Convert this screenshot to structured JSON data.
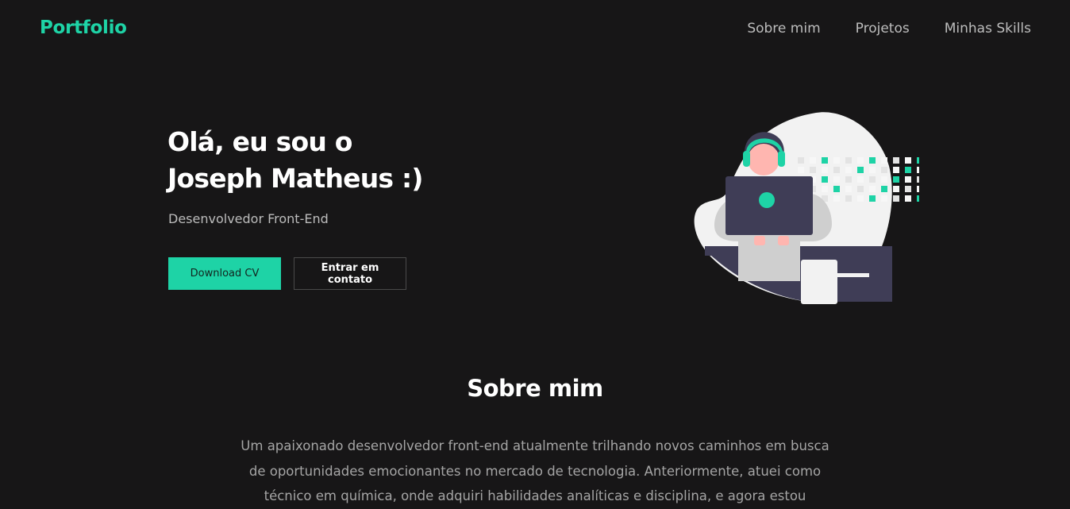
{
  "header": {
    "logo": "Portfolio",
    "nav": [
      "Sobre mim",
      "Projetos",
      "Minhas Skills"
    ]
  },
  "hero": {
    "title_line1": "Olá, eu sou o",
    "title_line2": "Joseph Matheus :)",
    "subtitle": "Desenvolvedor Front-End",
    "primary_button": "Download CV",
    "secondary_button": "Entrar em contato",
    "illustration_icon": "developer-at-laptop-illustration"
  },
  "about": {
    "title": "Sobre mim",
    "text": "Um apaixonado desenvolvedor front-end atualmente trilhando novos caminhos em busca de oportunidades emocionantes no mercado de tecnologia. Anteriormente, atuei como técnico em química, onde adquiri habilidades analíticas e disciplina, e agora estou"
  },
  "colors": {
    "background": "#171617",
    "accent": "#1ed3a6",
    "text": "#ffffff",
    "muted": "#bcbcbc"
  }
}
